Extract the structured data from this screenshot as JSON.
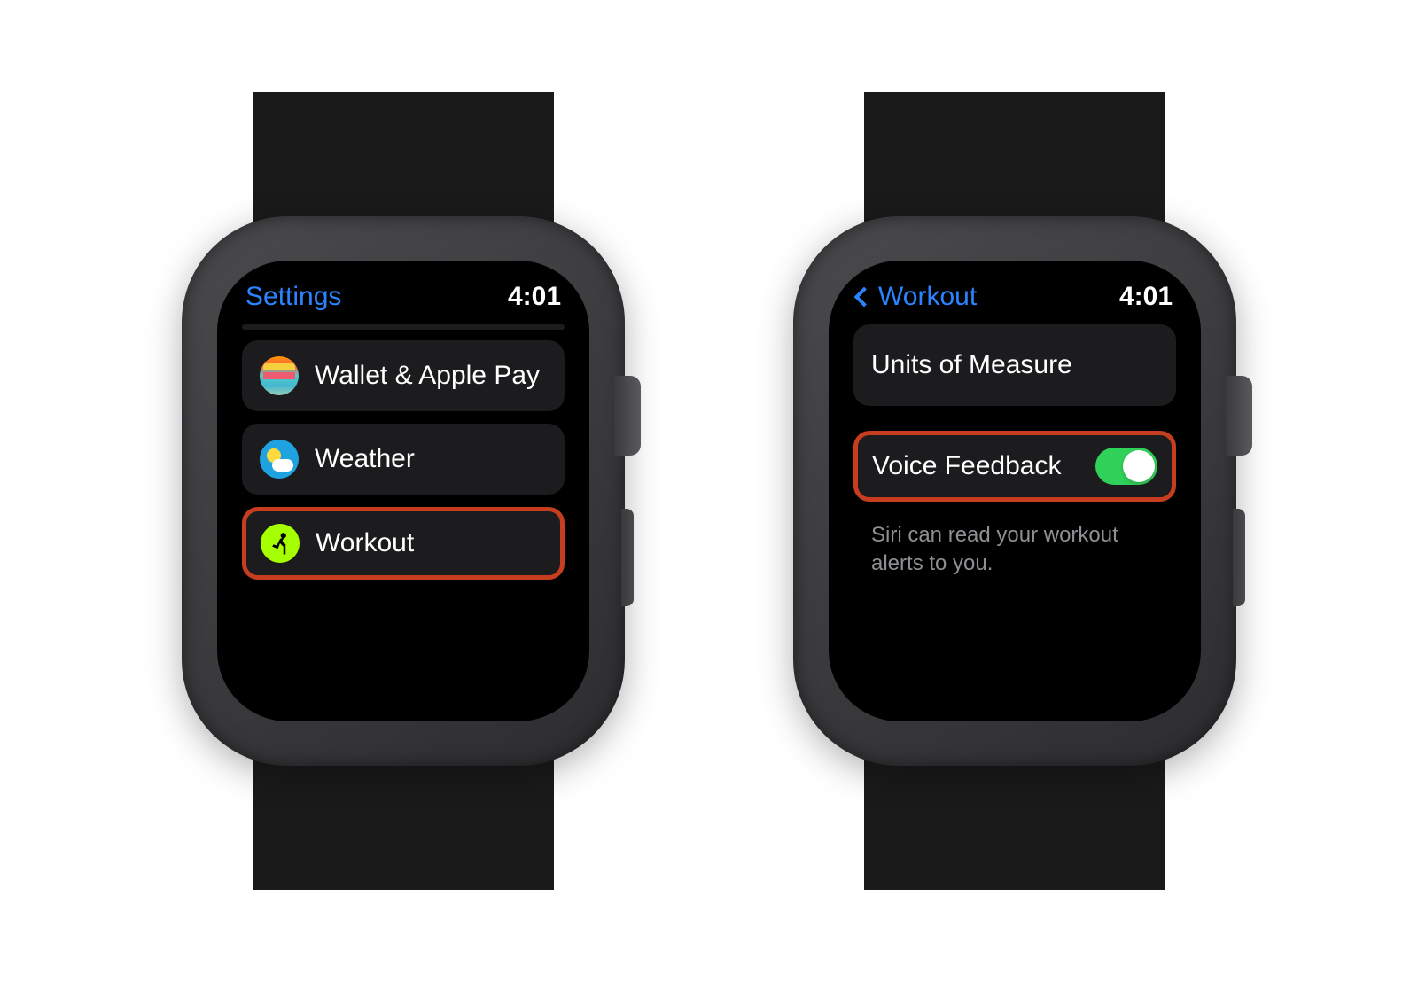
{
  "left": {
    "status": {
      "title": "Settings",
      "time": "4:01"
    },
    "items": [
      {
        "label": "Wallet & Apple Pay",
        "icon": "wallet"
      },
      {
        "label": "Weather",
        "icon": "weather"
      },
      {
        "label": "Workout",
        "icon": "workout"
      }
    ]
  },
  "right": {
    "status": {
      "back_label": "Workout",
      "time": "4:01"
    },
    "units_label": "Units of Measure",
    "voice_feedback": {
      "label": "Voice Feedback",
      "enabled": true
    },
    "footer": "Siri can read your workout alerts to you."
  },
  "colors": {
    "accent": "#2b84ff",
    "highlight_border": "#c63e1f",
    "toggle_on": "#30d158"
  }
}
